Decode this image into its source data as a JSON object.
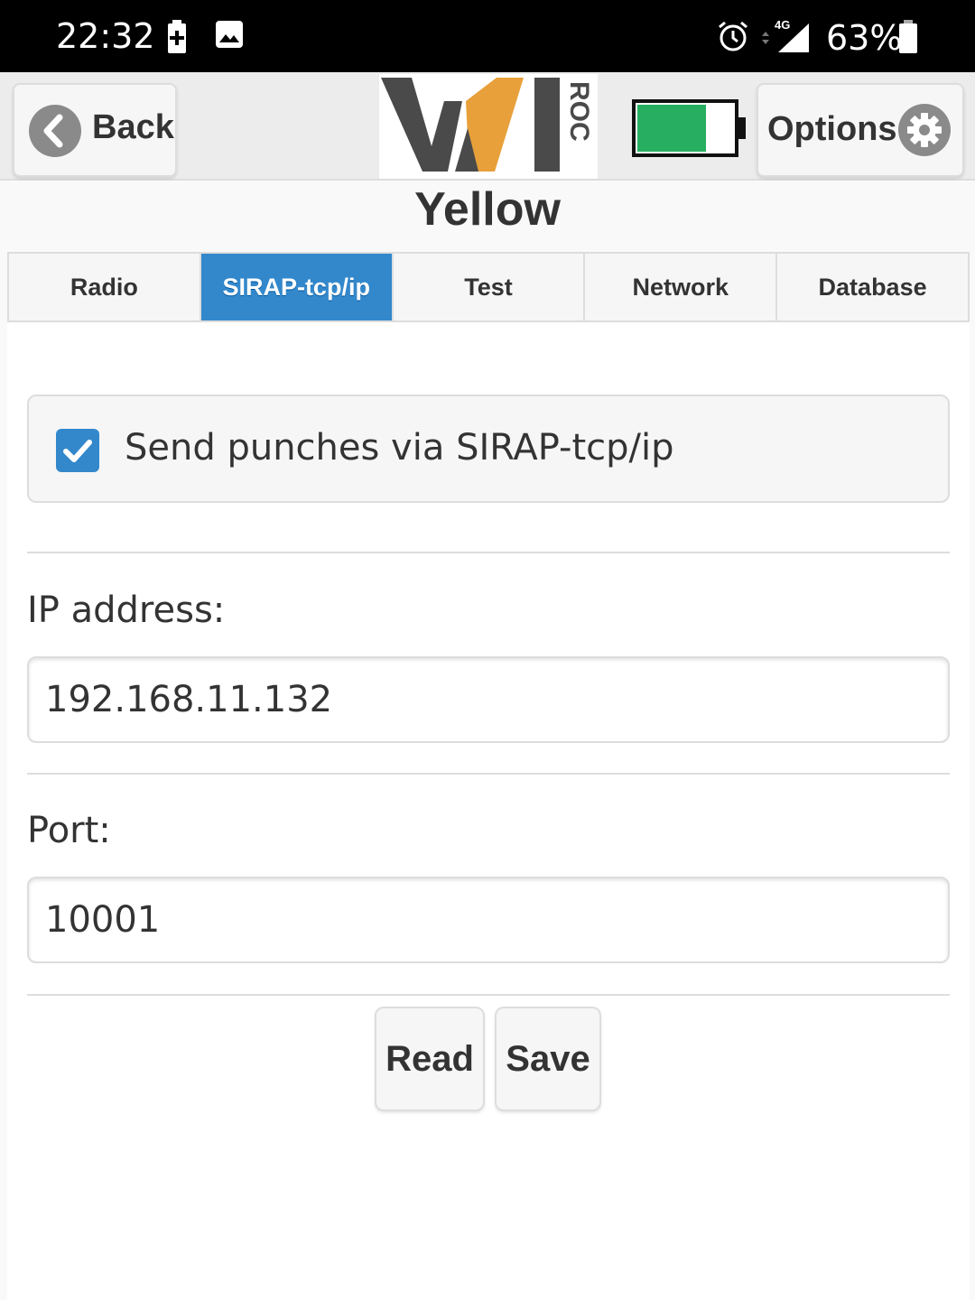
{
  "status_bar": {
    "time": "22:32",
    "battery_percent": "63%",
    "network": "4G"
  },
  "header": {
    "back_label": "Back",
    "options_label": "Options",
    "logo_main": "WI",
    "logo_side": "ROC",
    "battery_level": 0.72,
    "battery_color": "#27ae60"
  },
  "page": {
    "title": "Yellow"
  },
  "tabs": [
    {
      "label": "Radio",
      "active": false
    },
    {
      "label": "SIRAP-tcp/ip",
      "active": true
    },
    {
      "label": "Test",
      "active": false
    },
    {
      "label": "Network",
      "active": false
    },
    {
      "label": "Database",
      "active": false
    }
  ],
  "form": {
    "send_punches_label": "Send punches via SIRAP-tcp/ip",
    "send_punches_checked": true,
    "ip_label": "IP address:",
    "ip_value": "192.168.11.132",
    "port_label": "Port:",
    "port_value": "10001"
  },
  "actions": {
    "read_label": "Read",
    "save_label": "Save"
  },
  "colors": {
    "accent": "#3388cc",
    "logo_dark": "#4a4a4a",
    "logo_orange": "#e8a03a"
  }
}
